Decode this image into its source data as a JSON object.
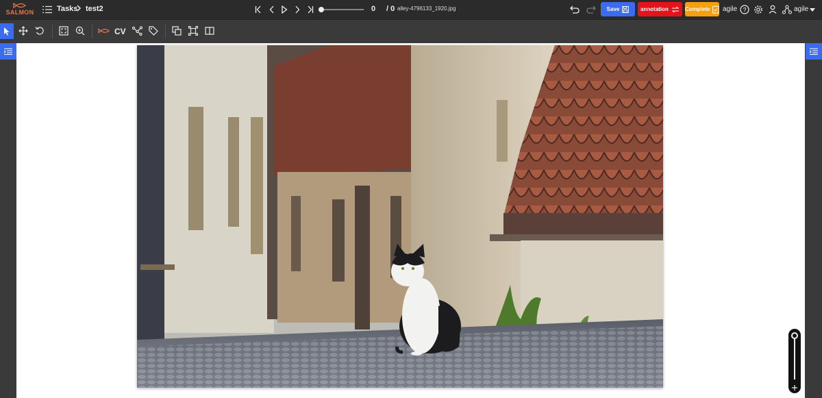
{
  "brand": {
    "name": "SALMON",
    "color": "#e8744a"
  },
  "header": {
    "tasks_label": "Tasks",
    "separator": ">",
    "task_name": "test2",
    "frame_current": "0",
    "frame_total": "/ 0",
    "filename": "alley-4796133_1920.jpg",
    "save_label": "Save",
    "annotation_label": "annotation",
    "complete_label": "Complete",
    "user_name": "agile",
    "account_name": "agile"
  },
  "colors": {
    "save": "#3b6cf0",
    "annotation": "#e8121a",
    "complete": "#f5a00d",
    "panel": "#3b6cf0",
    "accent_tool": "#e8744a"
  },
  "toolbar": {
    "cv_label": "CV",
    "tools": [
      "select-icon",
      "move-icon",
      "rotate-icon",
      "fit-icon",
      "zoom-in-icon",
      "salmon-tool-icon",
      "cv-tool",
      "polyline-icon",
      "tag-icon",
      "copy-icon",
      "group-icon",
      "split-icon"
    ]
  },
  "zoom": {
    "level": 0.02
  }
}
